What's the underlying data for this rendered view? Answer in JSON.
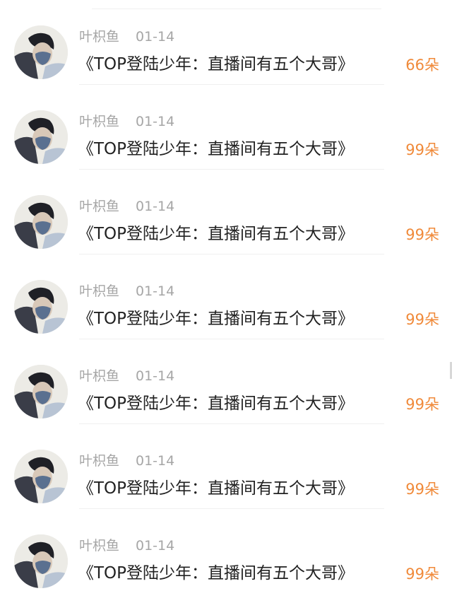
{
  "colors": {
    "name_gray": "#a6a6a6",
    "message_black": "#222222",
    "amount_orange": "#f08a3a"
  },
  "items": [
    {
      "name": "叶枳鱼",
      "date": "01-14",
      "message": "《TOP登陆少年：直播间有五个大哥》",
      "amount": "66朵",
      "avatar_icon": "user-avatar-photo"
    },
    {
      "name": "叶枳鱼",
      "date": "01-14",
      "message": "《TOP登陆少年：直播间有五个大哥》",
      "amount": "99朵",
      "avatar_icon": "user-avatar-photo"
    },
    {
      "name": "叶枳鱼",
      "date": "01-14",
      "message": "《TOP登陆少年：直播间有五个大哥》",
      "amount": "99朵",
      "avatar_icon": "user-avatar-photo"
    },
    {
      "name": "叶枳鱼",
      "date": "01-14",
      "message": "《TOP登陆少年：直播间有五个大哥》",
      "amount": "99朵",
      "avatar_icon": "user-avatar-photo"
    },
    {
      "name": "叶枳鱼",
      "date": "01-14",
      "message": "《TOP登陆少年：直播间有五个大哥》",
      "amount": "99朵",
      "avatar_icon": "user-avatar-photo"
    },
    {
      "name": "叶枳鱼",
      "date": "01-14",
      "message": "《TOP登陆少年：直播间有五个大哥》",
      "amount": "99朵",
      "avatar_icon": "user-avatar-photo"
    },
    {
      "name": "叶枳鱼",
      "date": "01-14",
      "message": "《TOP登陆少年：直播间有五个大哥》",
      "amount": "99朵",
      "avatar_icon": "user-avatar-photo"
    }
  ]
}
